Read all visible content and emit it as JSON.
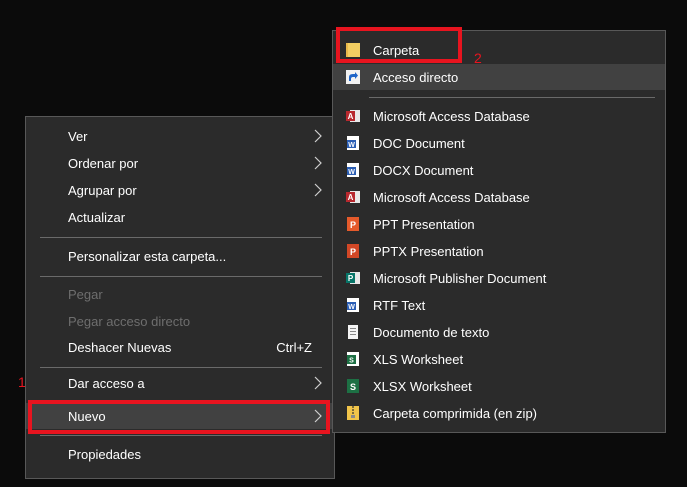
{
  "context_menu": {
    "items": [
      {
        "label": "Ver",
        "submenu": true
      },
      {
        "label": "Ordenar por",
        "submenu": true
      },
      {
        "label": "Agrupar por",
        "submenu": true
      },
      {
        "label": "Actualizar"
      },
      {
        "label": "Personalizar esta carpeta..."
      },
      {
        "label": "Pegar",
        "disabled": true
      },
      {
        "label": "Pegar acceso directo",
        "disabled": true
      },
      {
        "label": "Deshacer Nuevas",
        "shortcut": "Ctrl+Z"
      },
      {
        "label": "Dar acceso a",
        "submenu": true
      },
      {
        "label": "Nuevo",
        "submenu": true,
        "highlighted": true
      },
      {
        "label": "Propiedades"
      }
    ]
  },
  "new_submenu": {
    "items": [
      {
        "label": "Carpeta",
        "icon": "folder-icon"
      },
      {
        "label": "Acceso directo",
        "icon": "shortcut-icon",
        "hovered": true
      },
      {
        "label": "Microsoft Access Database",
        "icon": "access-icon"
      },
      {
        "label": "DOC Document",
        "icon": "word-icon"
      },
      {
        "label": "DOCX Document",
        "icon": "word-icon"
      },
      {
        "label": "Microsoft Access Database",
        "icon": "access-icon"
      },
      {
        "label": "PPT Presentation",
        "icon": "powerpoint-icon"
      },
      {
        "label": "PPTX Presentation",
        "icon": "powerpoint-icon"
      },
      {
        "label": "Microsoft Publisher Document",
        "icon": "publisher-icon"
      },
      {
        "label": "RTF Text",
        "icon": "word-icon"
      },
      {
        "label": "Documento de texto",
        "icon": "text-document-icon"
      },
      {
        "label": "XLS Worksheet",
        "icon": "excel-icon"
      },
      {
        "label": "XLSX Worksheet",
        "icon": "excel-icon"
      },
      {
        "label": "Carpeta comprimida (en zip)",
        "icon": "zip-folder-icon"
      }
    ]
  },
  "annotations": {
    "step1": "1",
    "step2": "2",
    "color": "#e8141f"
  },
  "colors": {
    "menu_bg": "#2b2b2b",
    "hover_bg": "#414141",
    "desktop_bg": "#0b0b0b"
  }
}
